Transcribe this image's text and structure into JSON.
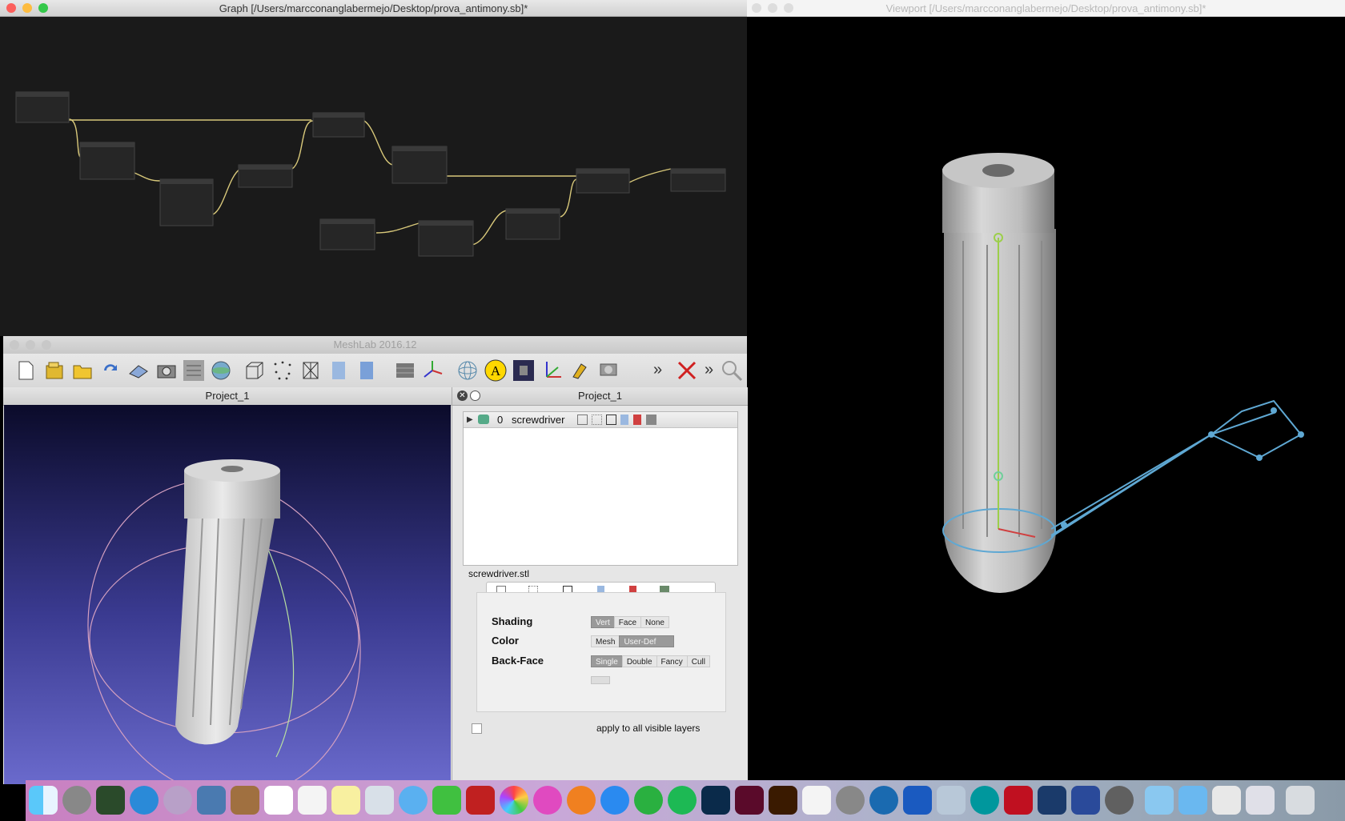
{
  "graph_window": {
    "title": "Graph [/Users/marcconanglabermejo/Desktop/prova_antimony.sb]*"
  },
  "viewport_window": {
    "title": "Viewport [/Users/marcconanglabermejo/Desktop/prova_antimony.sb]*"
  },
  "meshlab": {
    "title": "MeshLab 2016.12",
    "left_panel_title": "Project_1",
    "right_panel_title": "Project_1",
    "layer": {
      "index": "0",
      "name": "screwdriver"
    },
    "file_name": "screwdriver.stl",
    "decorators": {
      "shading": {
        "label": "Shading",
        "options": [
          "Vert",
          "Face",
          "None"
        ],
        "selected": "Vert"
      },
      "color": {
        "label": "Color",
        "options": [
          "Mesh",
          "User-Def"
        ],
        "selected": "User-Def"
      },
      "back_face": {
        "label": "Back-Face",
        "options": [
          "Single",
          "Double",
          "Fancy",
          "Cull"
        ],
        "selected": "Single"
      }
    },
    "apply_all_label": "apply to all visible layers",
    "apply_all_checked": false,
    "toolbar_more": "»"
  },
  "icons": {
    "toolbar": [
      "new-file-icon",
      "open-project-icon",
      "open-mesh-icon",
      "reload-icon",
      "save-icon",
      "snapshot-icon",
      "layers-icon",
      "globe-icon",
      "bbox-icon",
      "points-icon",
      "wireframe-icon",
      "flat-icon",
      "smooth-icon",
      "texture-icon",
      "axis-icon",
      "trackball-icon",
      "annotation-icon",
      "camera-icon",
      "xyz-icon",
      "paint-icon",
      "unified-camera-icon",
      "more-icon",
      "delete-icon",
      "more2-icon",
      "search-icon"
    ],
    "dock": [
      "finder",
      "launchpad",
      "mission-control",
      "safari",
      "keychain",
      "preview",
      "notes",
      "calendar",
      "reminders",
      "stickies",
      "image-capture",
      "messages",
      "facetime",
      "photo-booth",
      "photos",
      "itunes",
      "ibooks",
      "app-store",
      "utorrent",
      "spotify",
      "photoshop",
      "indesign",
      "illustrator",
      "acrobat",
      "system-preferences",
      "camino",
      "word",
      "image-viewer",
      "arduino",
      "autocad",
      "screen",
      "instruments",
      "eye",
      "folder",
      "downloads",
      "documents",
      "network",
      "trash"
    ]
  },
  "colors": {
    "graph_bg": "#1a1a1a",
    "wire": "#d8c87a",
    "mesh": "#c4c4c4",
    "gizmo": "#5fa8d3",
    "selected_seg": "#9a9a9a"
  }
}
